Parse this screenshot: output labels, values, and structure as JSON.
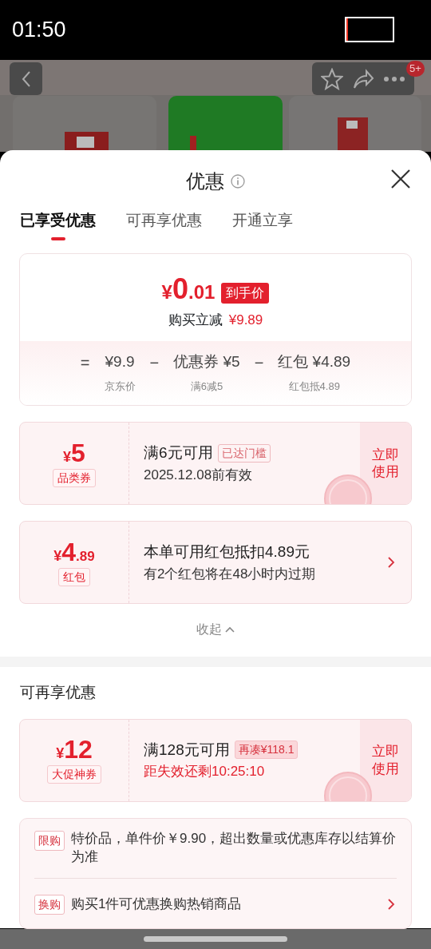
{
  "status_bar": {
    "time": "01:50"
  },
  "background_page": {
    "badge": "5+"
  },
  "sheet": {
    "title": "优惠",
    "tabs": [
      {
        "label": "已享受优惠",
        "selected": true
      },
      {
        "label": "可再享优惠",
        "selected": false
      },
      {
        "label": "开通立享",
        "selected": false
      }
    ],
    "summary": {
      "currency": "¥",
      "price_int": "0",
      "price_dec": ".01",
      "price_tag": "到手价",
      "saving_label": "购买立减",
      "saving_value": "¥9.89",
      "operators": [
        "=",
        "−",
        "−"
      ],
      "terms": [
        {
          "value": "¥9.9",
          "note": "京东价"
        },
        {
          "value": "优惠券 ¥5",
          "note": "满6减5"
        },
        {
          "value": "红包 ¥4.89",
          "note": "红包抵4.89"
        }
      ]
    },
    "offers": [
      {
        "kind": "coupon",
        "currency": "¥",
        "amount": "5",
        "type_label": "品类券",
        "title": "满6元可用",
        "tag": "已达门槛",
        "tag_filled": false,
        "subtitle": "2025.12.08前有效",
        "urgent": false,
        "action": "立即使用",
        "claimed": true
      },
      {
        "kind": "redpacket",
        "currency": "¥",
        "amount": "4",
        "amount_dec": ".89",
        "type_label": "红包",
        "title": "本单可用红包抵扣4.89元",
        "subtitle": "有2个红包将在48小时内过期",
        "urgent": false
      }
    ],
    "collapse": "收起",
    "more_title": "可再享优惠",
    "more_offers": [
      {
        "kind": "coupon",
        "currency": "¥",
        "amount": "12",
        "type_label": "大促神券",
        "title": "满128元可用",
        "tag": "再凑¥118.1",
        "tag_filled": true,
        "subtitle": "距失效还剩10:25:10",
        "urgent": true,
        "action": "立即使用",
        "claimed": true
      }
    ],
    "info_rows": [
      {
        "tag": "限购",
        "text": "特价品，单件价￥9.90，超出数量或优惠库存以结算价为准",
        "chevron": false
      },
      {
        "tag": "换购",
        "text": "购买1件可优惠换购热销商品",
        "chevron": true
      }
    ]
  }
}
